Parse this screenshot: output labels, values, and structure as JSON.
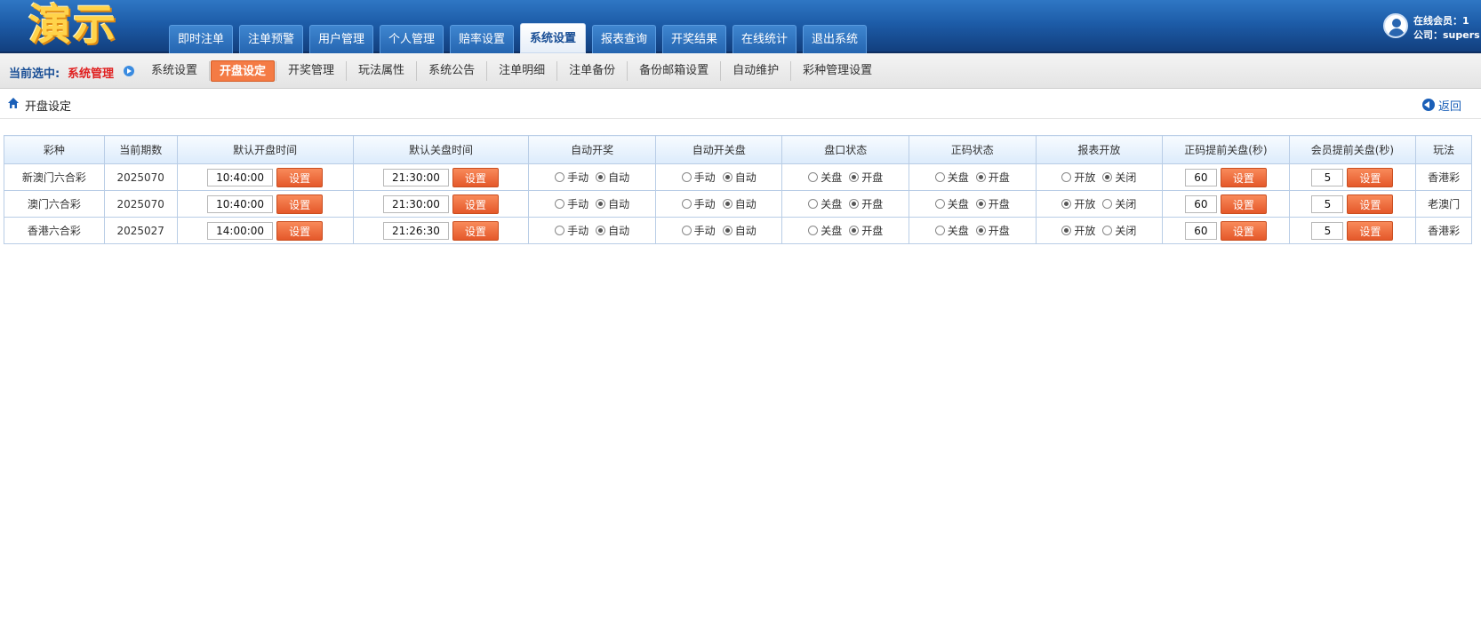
{
  "logo": "演示",
  "nav": {
    "tabs": [
      {
        "label": "即时注单",
        "active": false
      },
      {
        "label": "注单预警",
        "active": false
      },
      {
        "label": "用户管理",
        "active": false
      },
      {
        "label": "个人管理",
        "active": false
      },
      {
        "label": "赔率设置",
        "active": false
      },
      {
        "label": "系统设置",
        "active": true
      },
      {
        "label": "报表查询",
        "active": false
      },
      {
        "label": "开奖结果",
        "active": false
      },
      {
        "label": "在线统计",
        "active": false
      },
      {
        "label": "退出系统",
        "active": false
      }
    ]
  },
  "user": {
    "online_label": "在线会员：1",
    "company_label": "公司：supers"
  },
  "subnav": {
    "current_label": "当前选中:",
    "current_value": "系统管理",
    "items": [
      {
        "label": "系统设置",
        "active": false
      },
      {
        "label": "开盘设定",
        "active": true
      },
      {
        "label": "开奖管理",
        "active": false
      },
      {
        "label": "玩法属性",
        "active": false
      },
      {
        "label": "系统公告",
        "active": false
      },
      {
        "label": "注单明细",
        "active": false
      },
      {
        "label": "注单备份",
        "active": false
      },
      {
        "label": "备份邮箱设置",
        "active": false
      },
      {
        "label": "自动维护",
        "active": false
      },
      {
        "label": "彩种管理设置",
        "active": false
      }
    ]
  },
  "breadcrumb": {
    "title": "开盘设定",
    "back_label": "返回"
  },
  "table": {
    "headers": [
      "彩种",
      "当前期数",
      "默认开盘时间",
      "默认关盘时间",
      "自动开奖",
      "自动开关盘",
      "盘口状态",
      "正码状态",
      "报表开放",
      "正码提前关盘(秒)",
      "会员提前关盘(秒)",
      "玩法"
    ],
    "set_label": "设置",
    "radio_labels": {
      "auto_draw": [
        "手动",
        "自动"
      ],
      "auto_open_close": [
        "手动",
        "自动"
      ],
      "market_status": [
        "关盘",
        "开盘"
      ],
      "main_number_status": [
        "关盘",
        "开盘"
      ],
      "report_open": [
        "开放",
        "关闭"
      ]
    },
    "rows": [
      {
        "lottery": "新澳门六合彩",
        "period": "2025070",
        "open_time": "10:40:00",
        "close_time": "21:30:00",
        "auto_draw": 1,
        "auto_open_close": 1,
        "market_status": 1,
        "main_number_status": 1,
        "report_open": 1,
        "main_advance": "60",
        "member_advance": "5",
        "play": "香港彩"
      },
      {
        "lottery": "澳门六合彩",
        "period": "2025070",
        "open_time": "10:40:00",
        "close_time": "21:30:00",
        "auto_draw": 1,
        "auto_open_close": 1,
        "market_status": 1,
        "main_number_status": 1,
        "report_open": 0,
        "main_advance": "60",
        "member_advance": "5",
        "play": "老澳门"
      },
      {
        "lottery": "香港六合彩",
        "period": "2025027",
        "open_time": "14:00:00",
        "close_time": "21:26:30",
        "auto_draw": 1,
        "auto_open_close": 1,
        "market_status": 1,
        "main_number_status": 1,
        "report_open": 0,
        "main_advance": "60",
        "member_advance": "5",
        "play": "香港彩"
      }
    ]
  },
  "colors": {
    "header_blue": "#1d5ca8",
    "accent_orange": "#f47b45",
    "current_red": "#e02020",
    "link_blue": "#1a5fb8"
  }
}
